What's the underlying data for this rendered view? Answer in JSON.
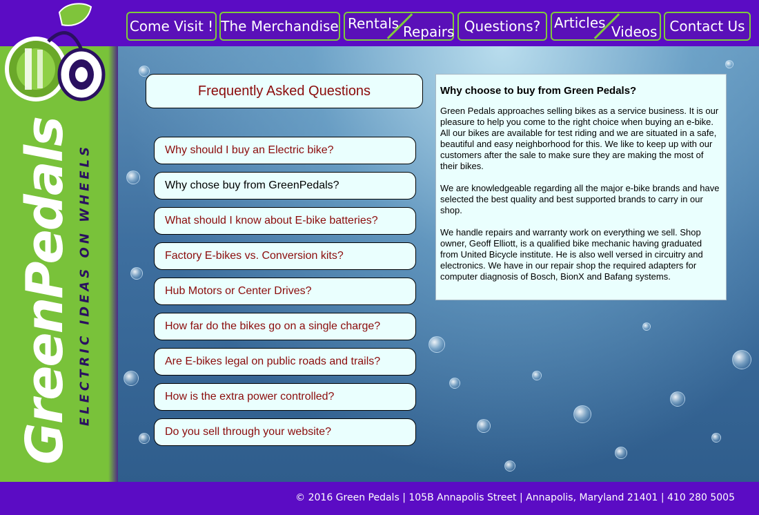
{
  "nav": {
    "visit": "Come Visit !",
    "merchandise": "The Merchandise",
    "rentals": "Rentals",
    "repairs": "Repairs",
    "questions": "Questions?",
    "articles": "Articles",
    "videos": "Videos",
    "contact": "Contact Us"
  },
  "brand": {
    "name": "GreenPedals",
    "tagline": "ELECTRIC IDEAS ON WHEELS"
  },
  "faq": {
    "title": "Frequently Asked Questions",
    "items": [
      "Why should I buy an Electric bike?",
      "Why chose buy from GreenPedals?",
      "What should I know about E-bike batteries?",
      "Factory E-bikes vs. Conversion kits?",
      "Hub Motors or Center Drives?",
      "How far do the bikes go on a single charge?",
      "Are E-bikes legal on public roads and trails?",
      "How is the extra power controlled?",
      "Do you sell through your website?"
    ]
  },
  "answer": {
    "heading": "Why choose to buy from Green Pedals?",
    "paragraphs": [
      "Green Pedals approaches selling bikes as a service business. It is our pleasure to help you come to the right choice when buying an e-bike. All our bikes are available for test riding and we are situated in a safe, beautiful and easy neighborhood for this. We like to keep up with our customers after the sale to make sure they are making the most of their bikes.",
      "We are knowledgeable regarding all the major e-bike brands and have selected the best quality and best supported brands to carry in our shop.",
      "We handle repairs and warranty work on everything we sell. Shop owner, Geoff Elliott, is a qualified bike mechanic having graduated from United Bicycle institute. He is also well versed in circuitry and electronics. We have in our repair shop the required adapters for computer diagnosis of Bosch, BionX and Bafang systems."
    ]
  },
  "footer": {
    "text": "© 2016 Green Pedals | 105B Annapolis Street | Annapolis, Maryland 21401 | 410 280 5005"
  },
  "colors": {
    "purple": "#5b0cc4",
    "green": "#79c23a",
    "link_red": "#8b0b0b",
    "panel": "#eafffe"
  }
}
